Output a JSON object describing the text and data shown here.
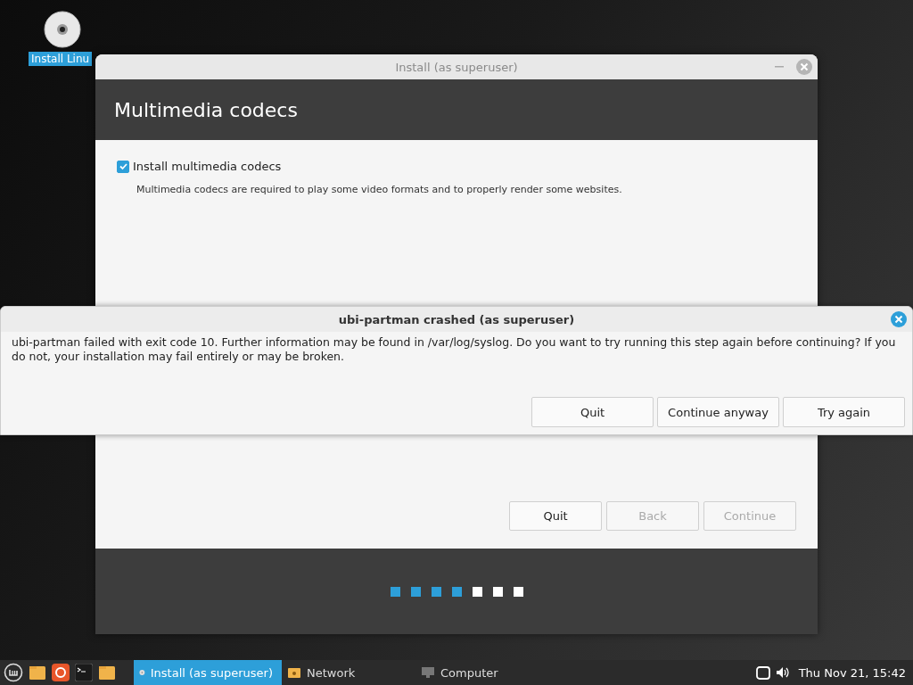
{
  "desktop_icon": {
    "label": "Install Linu",
    "selected": true
  },
  "install_window": {
    "title": "Install (as superuser)",
    "heading": "Multimedia codecs",
    "option": {
      "label": "Install multimedia codecs",
      "checked": true,
      "description": "Multimedia codecs are required to play some video formats and to properly render some websites."
    },
    "buttons": [
      {
        "label": "Quit",
        "disabled": false
      },
      {
        "label": "Back",
        "disabled": true
      },
      {
        "label": "Continue",
        "disabled": true
      }
    ],
    "steps": [
      {
        "done": true
      },
      {
        "done": true
      },
      {
        "done": true
      },
      {
        "done": true
      },
      {
        "done": false
      },
      {
        "done": false
      },
      {
        "done": false
      }
    ]
  },
  "crash_dialog": {
    "title": "ubi-partman crashed (as superuser)",
    "message": "ubi-partman failed with exit code 10. Further information may be found in /var/log/syslog. Do you want to try running this step again before continuing? If you do not, your installation may fail entirely or may be broken.",
    "buttons": [
      "Quit",
      "Continue anyway",
      "Try again"
    ]
  },
  "taskbar": {
    "tasks": [
      {
        "label": "Install (as superuser)",
        "kind": "disc",
        "selected": true
      },
      {
        "label": "Network",
        "kind": "folder",
        "selected": false
      },
      {
        "label": "Computer",
        "kind": "monitor",
        "selected": false
      }
    ],
    "clock": "Thu Nov 21, 15:42"
  }
}
